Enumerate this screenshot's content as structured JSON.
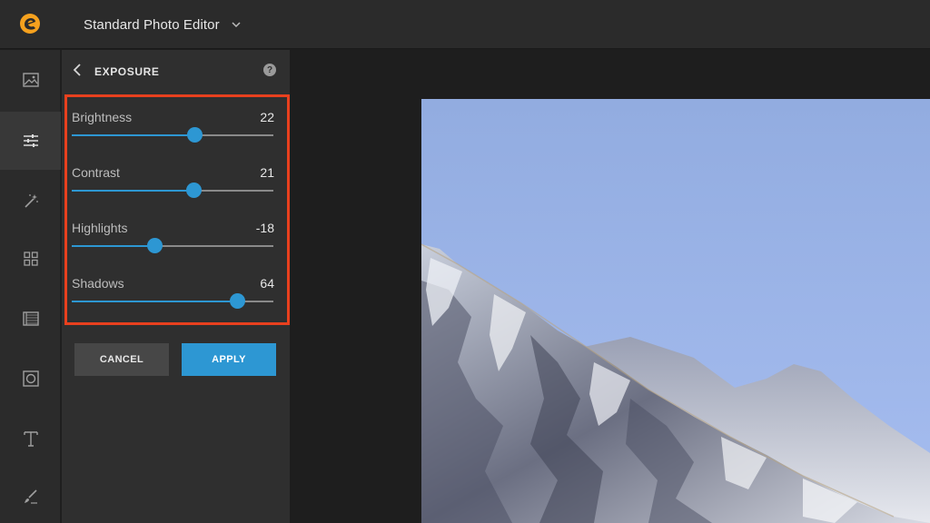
{
  "app": {
    "title": "Standard Photo Editor",
    "accent": "#2d97d3",
    "logo_color": "#f5a11e"
  },
  "toolbar": {
    "tools": [
      {
        "name": "image",
        "icon": "image-icon",
        "active": false
      },
      {
        "name": "adjust",
        "icon": "sliders-icon",
        "active": true
      },
      {
        "name": "effects",
        "icon": "magic-wand-icon",
        "active": false
      },
      {
        "name": "frames",
        "icon": "grid-icon",
        "active": false
      },
      {
        "name": "textures",
        "icon": "film-icon",
        "active": false
      },
      {
        "name": "overlays",
        "icon": "circle-frame-icon",
        "active": false
      },
      {
        "name": "text",
        "icon": "text-icon",
        "active": false
      },
      {
        "name": "draw",
        "icon": "brush-icon",
        "active": false
      }
    ]
  },
  "panel": {
    "title": "EXPOSURE",
    "help_icon": "question-icon",
    "highlight_color": "#e8401e",
    "sliders": [
      {
        "label": "Brightness",
        "value": "22",
        "level": 22
      },
      {
        "label": "Contrast",
        "value": "21",
        "level": 21
      },
      {
        "label": "Highlights",
        "value": "-18",
        "level": -18
      },
      {
        "label": "Shadows",
        "value": "64",
        "level": 64
      }
    ],
    "cancel_label": "CANCEL",
    "apply_label": "APPLY"
  }
}
